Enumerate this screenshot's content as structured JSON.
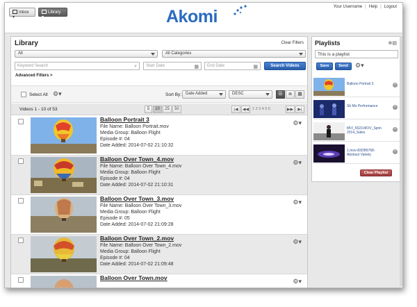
{
  "header": {
    "tabs": [
      {
        "label": "Inbox",
        "icon": "inbox-icon"
      },
      {
        "label": "Library",
        "icon": "library-icon"
      }
    ],
    "logo_text": "Akomi",
    "links": [
      "Your Username",
      "Help",
      "Logout"
    ]
  },
  "library": {
    "title": "Library",
    "clear_filters": "Clear Filters",
    "type_filter": "All",
    "category_filter": "All Categories",
    "keyword_placeholder": "Keyword Search",
    "start_date_placeholder": "Start Date",
    "end_date_placeholder": "End Date",
    "search_button": "Search Videos",
    "advanced_filters": "Advanced Filters >",
    "select_all": "Select All",
    "sort_by_label": "Sort By:",
    "sort_field": "Date Added",
    "sort_order": "DESC",
    "count_text": "Videos 1 - 10 of 53",
    "page_sizes": [
      "5",
      "10",
      "25",
      "50"
    ],
    "active_page_size": "10",
    "page_numbers": "1 2 3 4 5 6",
    "pager_first": "|◀",
    "pager_prev": "◀◀",
    "pager_next": "▶▶",
    "pager_last": "▶|",
    "items": [
      {
        "title": "Balloon Portrait 3",
        "file_name": "File Name: Balloon Portrait.mov",
        "media_group": "Media Group: Balloon Flight",
        "episode": "Episode #: 04",
        "date_added": "Date Added: 2014-07-02 21:10:32"
      },
      {
        "title": "Balloon Over Town_4.mov",
        "file_name": "File Name: Balloon Over Town_4.mov",
        "media_group": "Media Group: Balloon Flight",
        "episode": "Episode #: 04",
        "date_added": "Date Added: 2014-07-02 21:10:31"
      },
      {
        "title": "Balloon Over Town_3.mov",
        "file_name": "File Name: Balloon Over Town_3.mov",
        "media_group": "Media Group: Balloon Flight",
        "episode": "Episode #: 05",
        "date_added": "Date Added: 2014-07-02 21:09:28"
      },
      {
        "title": "Balloon Over Town_2.mov",
        "file_name": "File Name: Balloon Over Town_2.mov",
        "media_group": "Media Group: Balloon Flight",
        "episode": "Episode #: 04",
        "date_added": "Date Added: 2014-07-02 21:09:48"
      },
      {
        "title": "Balloon Over Town.mov",
        "file_name": "",
        "media_group": "",
        "episode": "",
        "date_added": ""
      }
    ]
  },
  "playlists": {
    "title": "Playlists",
    "name_value": "This is a playlist",
    "save_button": "Save",
    "send_button": "Send",
    "items": [
      {
        "label": "Balloon Portrait 3"
      },
      {
        "label": "Sb Mo Performance"
      },
      {
        "label": "MVI_5023.MOV_Sprin 2014_Sales"
      },
      {
        "label": "1.mov-83DB9768-Abstract Variety"
      }
    ],
    "clear_button": "Clear Playlist"
  },
  "colors": {
    "brand_blue": "#2a6bbf",
    "button_blue": "#2a5eab",
    "button_red": "#9d3c3c"
  }
}
